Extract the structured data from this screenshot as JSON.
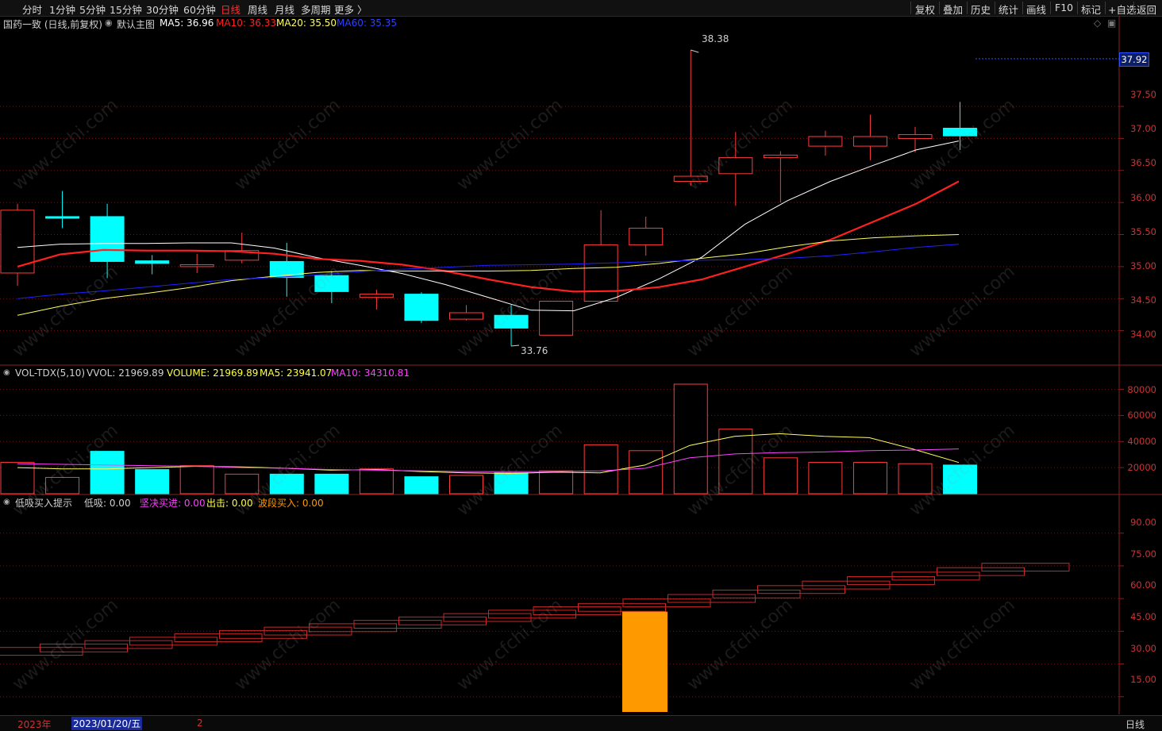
{
  "toolbar": {
    "tabs": [
      "分时",
      "1分钟",
      "5分钟",
      "15分钟",
      "30分钟",
      "60分钟",
      "日线",
      "周线",
      "月线",
      "多周期",
      "更多 〉"
    ],
    "active_tab": "日线",
    "right_buttons": [
      "复权",
      "叠加",
      "历史",
      "统计",
      "画线",
      "F10",
      "标记",
      "+自选",
      "返回"
    ]
  },
  "main_panel": {
    "stock_label": "国药一致 (日线,前复权)",
    "template": "默认主图",
    "ma5": "MA5: 36.96",
    "ma10": "MA10: 36.33",
    "ma20": "MA20: 35.50",
    "ma60": "MA60: 35.35",
    "current_price_badge": "37.92",
    "high_marker": "38.38",
    "low_marker": "33.76",
    "y_ticks": [
      "37.50",
      "37.00",
      "36.50",
      "36.00",
      "35.50",
      "35.00",
      "34.50",
      "34.00"
    ]
  },
  "volume_panel": {
    "indicator": "VOL-TDX(5,10)",
    "vvol": "VVOL: 21969.89",
    "volume": "VOLUME: 21969.89",
    "ma5": "MA5: 23941.07",
    "ma10": "MA10: 34310.81",
    "y_ticks": [
      "80000",
      "60000",
      "40000",
      "20000"
    ]
  },
  "signal_panel": {
    "indicator": "低吸买入提示",
    "dixi": "低吸: 0.00",
    "jianjue": "坚决买进: 0.00",
    "chuji": "出击: 0.00",
    "boduan": "波段买入: 0.00",
    "y_ticks": [
      "90.00",
      "75.00",
      "60.00",
      "45.00",
      "30.00",
      "15.00"
    ]
  },
  "bottom_bar": {
    "year": "2023年",
    "cursor_date": "2023/01/20/五",
    "marker": "2",
    "period_button": "日线"
  },
  "watermark": "www.cfchi.com",
  "colors": {
    "up": "#ff3b3b",
    "down": "#00ffff",
    "ma5": "#ffffff",
    "ma10": "#ff2020",
    "ma20": "#ffff60",
    "ma60": "#2020ff",
    "vol_ma10": "#ff40ff",
    "signal_bar": "#ff9900"
  },
  "chart_data": [
    {
      "type": "candlestick",
      "title": "国药一致 (日线,前复权)",
      "candles": [
        {
          "o": 34.9,
          "c": 35.88,
          "h": 35.98,
          "l": 34.7
        },
        {
          "o": 35.78,
          "c": 35.76,
          "h": 36.18,
          "l": 35.6
        },
        {
          "o": 35.78,
          "c": 35.08,
          "h": 35.98,
          "l": 34.82
        },
        {
          "o": 35.09,
          "c": 35.05,
          "h": 35.18,
          "l": 34.88
        },
        {
          "o": 35.0,
          "c": 35.03,
          "h": 35.2,
          "l": 34.9
        },
        {
          "o": 35.1,
          "c": 35.25,
          "h": 35.53,
          "l": 35.05
        },
        {
          "o": 35.08,
          "c": 34.83,
          "h": 35.37,
          "l": 34.53
        },
        {
          "o": 34.86,
          "c": 34.61,
          "h": 34.93,
          "l": 34.43
        },
        {
          "o": 34.52,
          "c": 34.57,
          "h": 34.64,
          "l": 34.33
        },
        {
          "o": 34.57,
          "c": 34.16,
          "h": 34.6,
          "l": 34.12
        },
        {
          "o": 34.18,
          "c": 34.28,
          "h": 34.4,
          "l": 34.16
        },
        {
          "o": 34.24,
          "c": 34.04,
          "h": 34.4,
          "l": 33.76
        },
        {
          "o": 33.93,
          "c": 34.46,
          "h": 34.46,
          "l": 33.93
        },
        {
          "o": 34.46,
          "c": 35.34,
          "h": 35.88,
          "l": 34.42
        },
        {
          "o": 35.34,
          "c": 35.6,
          "h": 35.78,
          "l": 35.17
        },
        {
          "o": 36.33,
          "c": 36.41,
          "h": 38.38,
          "l": 36.26
        },
        {
          "o": 36.45,
          "c": 36.7,
          "h": 37.1,
          "l": 35.95
        },
        {
          "o": 36.7,
          "c": 36.74,
          "h": 36.8,
          "l": 36.0
        },
        {
          "o": 36.88,
          "c": 37.03,
          "h": 37.12,
          "l": 36.73
        },
        {
          "o": 36.88,
          "c": 37.03,
          "h": 37.37,
          "l": 36.66
        },
        {
          "o": 37.0,
          "c": 37.06,
          "h": 37.18,
          "l": 36.78
        },
        {
          "o": 37.16,
          "c": 37.04,
          "h": 37.57,
          "l": 36.82
        }
      ],
      "ma_series": [
        {
          "name": "MA5",
          "values": [
            35.3,
            35.35,
            35.36,
            35.36,
            35.37,
            35.37,
            35.29,
            35.14,
            35.02,
            34.89,
            34.72,
            34.52,
            34.32,
            34.31,
            34.52,
            34.81,
            35.15,
            35.66,
            36.03,
            36.33,
            36.58,
            36.82,
            36.96
          ]
        },
        {
          "name": "MA10",
          "values": [
            35.0,
            35.19,
            35.26,
            35.25,
            35.25,
            35.24,
            35.2,
            35.12,
            35.09,
            35.03,
            34.93,
            34.8,
            34.68,
            34.61,
            34.62,
            34.68,
            34.8,
            35.0,
            35.2,
            35.42,
            35.7,
            35.98,
            36.33
          ]
        },
        {
          "name": "MA20",
          "values": [
            34.24,
            34.38,
            34.5,
            34.58,
            34.67,
            34.78,
            34.85,
            34.91,
            34.94,
            34.93,
            34.93,
            34.93,
            34.94,
            34.97,
            34.99,
            35.05,
            35.13,
            35.2,
            35.31,
            35.4,
            35.45,
            35.48,
            35.5
          ]
        },
        {
          "name": "MA60",
          "values": [
            34.5,
            34.57,
            34.62,
            34.68,
            34.74,
            34.8,
            34.83,
            34.87,
            34.92,
            34.96,
            34.99,
            35.02,
            35.03,
            35.04,
            35.06,
            35.08,
            35.1,
            35.11,
            35.13,
            35.17,
            35.23,
            35.3,
            35.35
          ]
        }
      ],
      "ylim": [
        33.5,
        38.6
      ]
    },
    {
      "type": "bar",
      "title": "VOL-TDX(5,10)",
      "values": [
        24000,
        12500,
        32500,
        18500,
        21500,
        15000,
        15000,
        15000,
        19000,
        13000,
        14000,
        16000,
        17500,
        37500,
        33000,
        84000,
        49500,
        27500,
        24000,
        24000,
        23000,
        21969.89
      ],
      "colors": [
        "up",
        "up",
        "down",
        "down",
        "up",
        "up",
        "down",
        "down",
        "up",
        "down",
        "up",
        "down",
        "up",
        "up",
        "up",
        "up",
        "up",
        "up",
        "up",
        "up",
        "up",
        "down"
      ],
      "series": [
        {
          "name": "MA5",
          "values": [
            20000,
            19000,
            19000,
            20000,
            21000,
            20500,
            19500,
            18000,
            18500,
            17000,
            16000,
            15500,
            16500,
            16000,
            22000,
            37000,
            44000,
            46000,
            44000,
            43000,
            34000,
            23941.07
          ]
        },
        {
          "name": "MA10",
          "values": [
            23000,
            22500,
            22000,
            21500,
            21000,
            20000,
            19500,
            18500,
            18000,
            17500,
            17000,
            17000,
            17000,
            17500,
            19500,
            27500,
            30500,
            31500,
            32000,
            33000,
            33500,
            34310.81
          ]
        }
      ],
      "ylim": [
        0,
        85000
      ]
    },
    {
      "type": "bar",
      "title": "低吸买入提示",
      "signal_value": 54,
      "series": [
        {
          "name": "低吸",
          "values": [
            0
          ]
        },
        {
          "name": "坚决买进",
          "values": [
            0
          ]
        },
        {
          "name": "出击",
          "values": [
            0
          ]
        },
        {
          "name": "波段买入",
          "values": [
            0
          ]
        }
      ],
      "ylim": [
        8,
        100
      ]
    }
  ]
}
